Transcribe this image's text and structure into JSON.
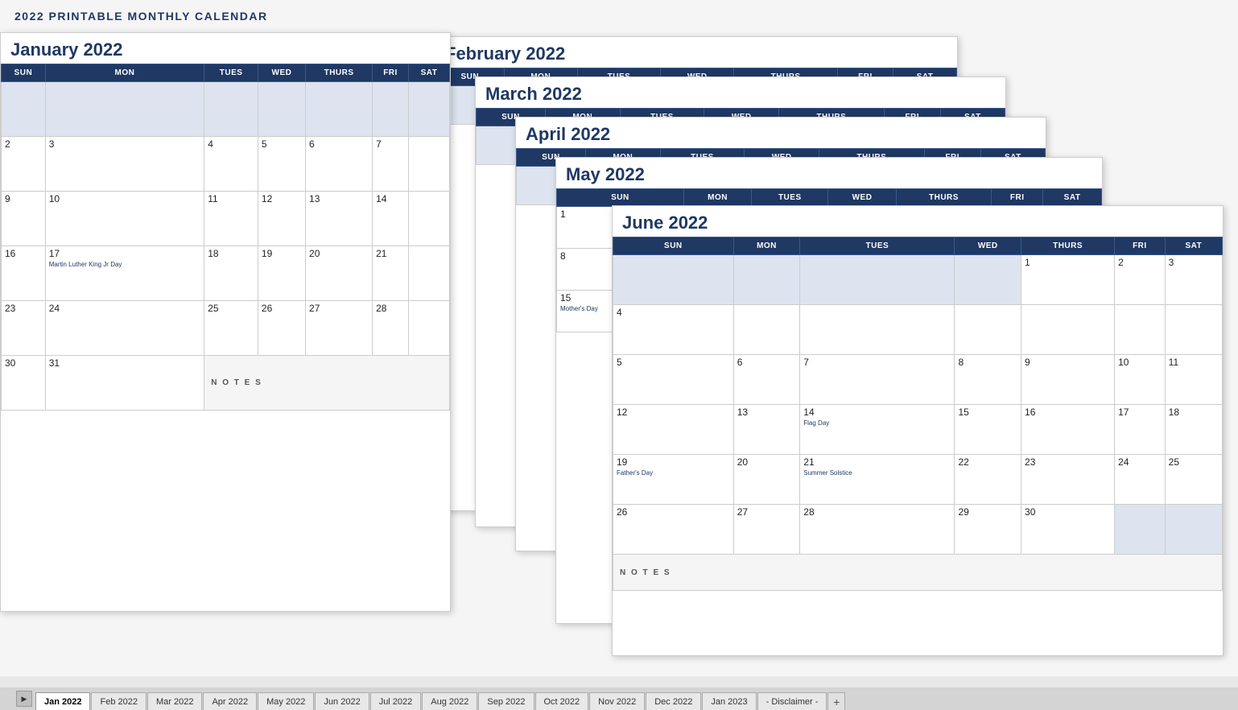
{
  "title": "2022 PRINTABLE MONTHLY CALENDAR",
  "calendars": {
    "january": {
      "title": "January 2022",
      "headers": [
        "SUN",
        "MON",
        "TUES",
        "WED",
        "THURS",
        "FRI",
        "SAT"
      ]
    },
    "february": {
      "title": "February 2022",
      "headers": [
        "SUN",
        "MON",
        "TUES",
        "WED",
        "THURS",
        "FRI",
        "SAT"
      ]
    },
    "march": {
      "title": "March 2022",
      "headers": [
        "SUN",
        "MON",
        "TUES",
        "WED",
        "THURS",
        "FRI",
        "SAT"
      ]
    },
    "april": {
      "title": "April 2022",
      "headers": [
        "SUN",
        "MON",
        "TUES",
        "WED",
        "THURS",
        "FRI",
        "SAT"
      ]
    },
    "may": {
      "title": "May 2022",
      "headers": [
        "SUN",
        "MON",
        "TUES",
        "WED",
        "THURS",
        "FRI",
        "SAT"
      ]
    },
    "june": {
      "title": "June 2022",
      "headers": [
        "SUN",
        "MON",
        "TUES",
        "WED",
        "THURS",
        "FRI",
        "SAT"
      ]
    }
  },
  "tabs": [
    {
      "label": "Jan 2022",
      "active": true
    },
    {
      "label": "Feb 2022",
      "active": false
    },
    {
      "label": "Mar 2022",
      "active": false
    },
    {
      "label": "Apr 2022",
      "active": false
    },
    {
      "label": "May 2022",
      "active": false
    },
    {
      "label": "Jun 2022",
      "active": false
    },
    {
      "label": "Jul 2022",
      "active": false
    },
    {
      "label": "Aug 2022",
      "active": false
    },
    {
      "label": "Sep 2022",
      "active": false
    },
    {
      "label": "Oct 2022",
      "active": false
    },
    {
      "label": "Nov 2022",
      "active": false
    },
    {
      "label": "Dec 2022",
      "active": false
    },
    {
      "label": "Jan 2023",
      "active": false
    },
    {
      "label": "- Disclaimer -",
      "active": false
    }
  ]
}
